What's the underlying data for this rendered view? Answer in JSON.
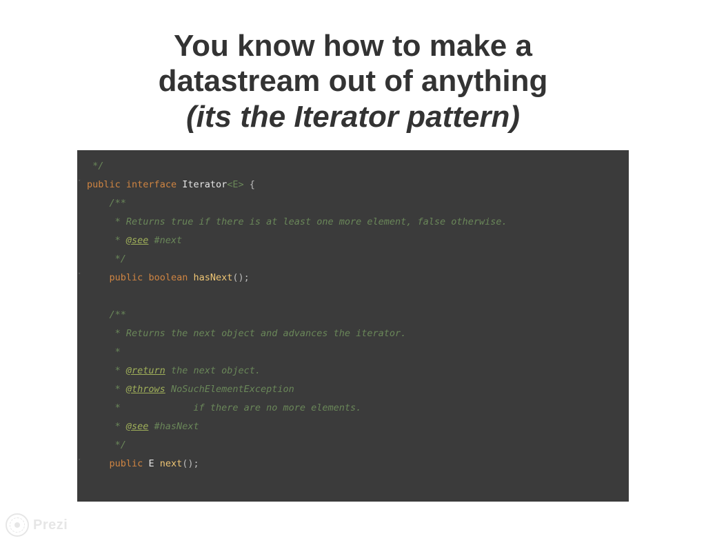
{
  "slide": {
    "title_line1": "You know how to make a",
    "title_line2": "datastream out of anything",
    "subtitle": "(its the Iterator pattern)"
  },
  "code": {
    "end_comment": "*/",
    "decl_public": "public",
    "decl_interface": "interface",
    "decl_name": "Iterator",
    "decl_generic": "<E>",
    "decl_open": " {",
    "doc1_open": "/**",
    "doc1_line": " * Returns true if there is at least one more element, false otherwise.",
    "doc1_see_tag": "@see",
    "doc1_see_ref": " #next",
    "doc1_close": " */",
    "m1_public": "public",
    "m1_boolean": "boolean",
    "m1_name": "hasNext",
    "m1_paren": "();",
    "doc2_open": "/**",
    "doc2_line1": " * Returns the next object and advances the iterator.",
    "doc2_star": " *",
    "doc2_return_tag": "@return",
    "doc2_return_txt": " the next object.",
    "doc2_throws_tag": "@throws",
    "doc2_throws_txt": " NoSuchElementException",
    "doc2_throws_cond": " *             if there are no more elements.",
    "doc2_see_tag": "@see",
    "doc2_see_ref": " #hasNext",
    "doc2_close": " */",
    "m2_public": "public",
    "m2_type": "E",
    "m2_name": "next",
    "m2_paren": "();"
  },
  "watermark": {
    "label": "Prezi"
  }
}
